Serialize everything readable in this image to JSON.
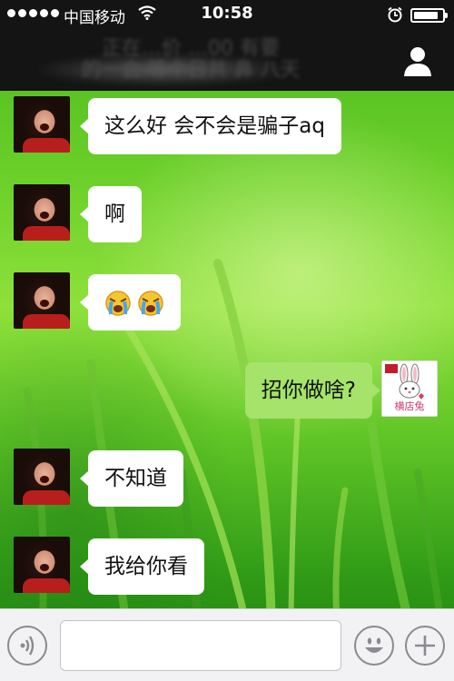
{
  "status_bar": {
    "carrier": "中国移动",
    "time": "10:58",
    "battery_level": 0.85
  },
  "nav": {
    "title_line1": "正在…价 …00  有要",
    "title_line2": "的一会  等个日共 鼻 八天"
  },
  "messages": [
    {
      "direction": "in",
      "sender": "contact",
      "text": "这么好 会不会是骗子aq"
    },
    {
      "direction": "in",
      "sender": "contact",
      "text": "啊"
    },
    {
      "direction": "in",
      "sender": "contact",
      "emoji": [
        "crying-face-icon",
        "crying-face-icon"
      ]
    },
    {
      "direction": "out",
      "sender": "me",
      "text": "招你做啥?",
      "avatar_label": "横店兔"
    },
    {
      "direction": "in",
      "sender": "contact",
      "text": "不知道"
    },
    {
      "direction": "in",
      "sender": "contact",
      "text": "我给你看"
    }
  ],
  "input": {
    "value": "",
    "placeholder": ""
  },
  "colors": {
    "incoming_bubble": "#ffffff",
    "outgoing_bubble": "#a5e36a",
    "top_bar": "#141414",
    "input_bar": "#f2f2f4"
  }
}
